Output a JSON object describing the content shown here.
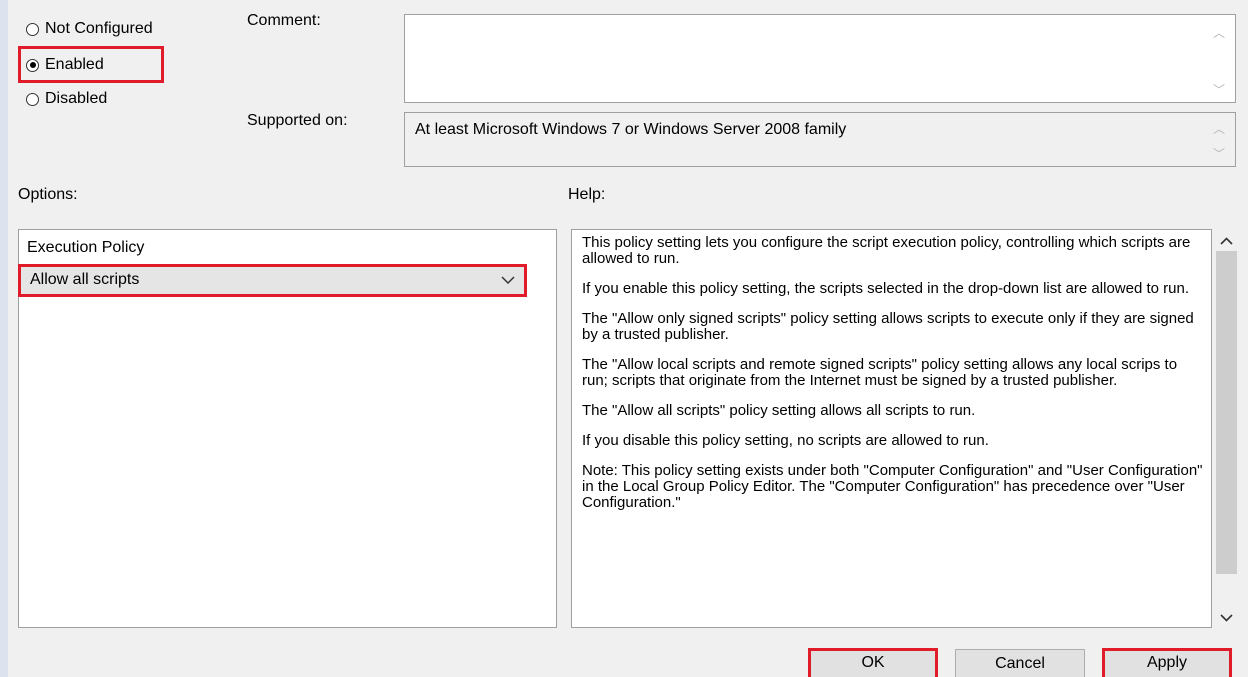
{
  "state": {
    "options": [
      {
        "label": "Not Configured",
        "checked": false
      },
      {
        "label": "Enabled",
        "checked": true
      },
      {
        "label": "Disabled",
        "checked": false
      }
    ]
  },
  "comment": {
    "label": "Comment:",
    "value": ""
  },
  "supported": {
    "label": "Supported on:",
    "value": "At least Microsoft Windows 7 or Windows Server 2008 family"
  },
  "options_panel": {
    "label": "Options:",
    "policy_label": "Execution Policy",
    "selected": "Allow all scripts"
  },
  "help": {
    "label": "Help:",
    "paragraphs": [
      "This policy setting lets you configure the script execution policy, controlling which scripts are allowed to run.",
      "If you enable this policy setting, the scripts selected in the drop-down list are allowed to run.",
      "The \"Allow only signed scripts\" policy setting allows scripts to execute only if they are signed by a trusted publisher.",
      "The \"Allow local scripts and remote signed scripts\" policy setting allows any local scrips to run; scripts that originate from the Internet must be signed by a trusted publisher.",
      "The \"Allow all scripts\" policy setting allows all scripts to run.",
      "If you disable this policy setting, no scripts are allowed to run.",
      "Note: This policy setting exists under both \"Computer Configuration\" and \"User Configuration\" in the Local Group Policy Editor. The \"Computer Configuration\" has precedence over \"User Configuration.\""
    ]
  },
  "buttons": {
    "ok": "OK",
    "cancel": "Cancel",
    "apply": "Apply"
  },
  "colors": {
    "highlight": "#e01b2a",
    "background": "#f0f0f0"
  }
}
